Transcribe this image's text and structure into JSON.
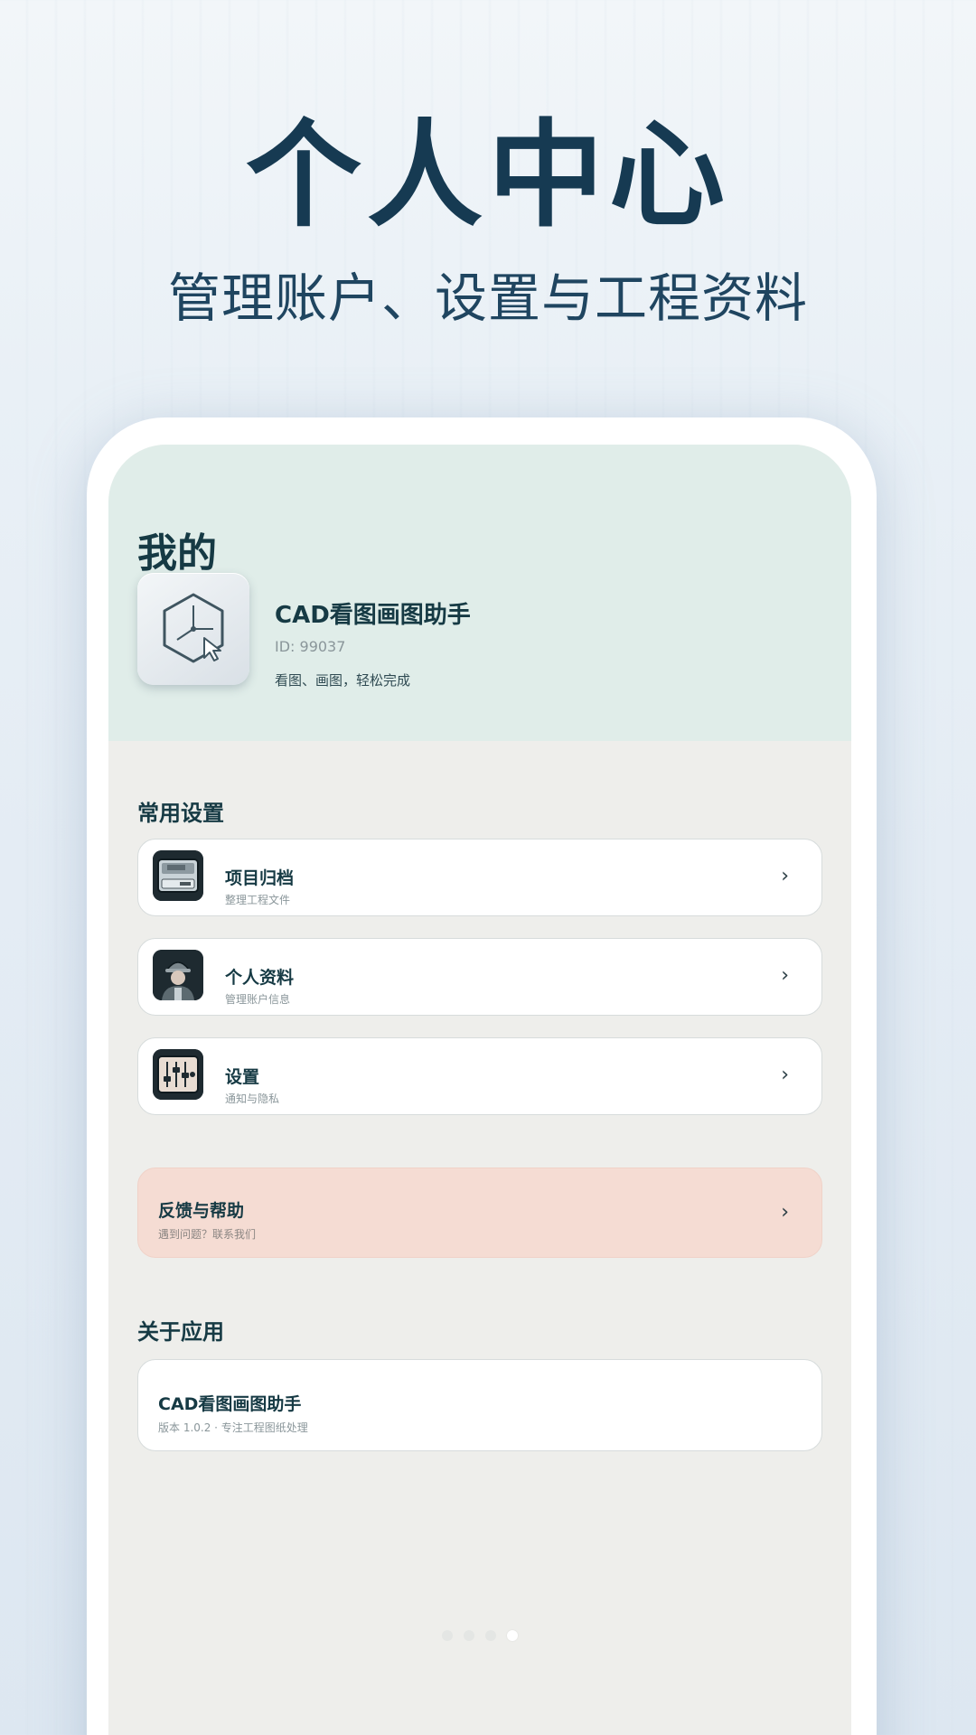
{
  "hero": {
    "title": "个人中心",
    "subtitle": "管理账户、设置与工程资料"
  },
  "page": {
    "title": "我的"
  },
  "profile": {
    "app_icon": "cube-cursor-icon",
    "name": "CAD看图画图助手",
    "id": "ID: 99037",
    "slogan": "看图、画图，轻松完成"
  },
  "common_settings": {
    "label": "常用设置",
    "items": [
      {
        "icon": "archive-drive-icon",
        "title": "项目归档",
        "subtitle": "整理工程文件"
      },
      {
        "icon": "engineer-avatar-icon",
        "title": "个人资料",
        "subtitle": "管理账户信息"
      },
      {
        "icon": "sliders-icon",
        "title": "设置",
        "subtitle": "通知与隐私"
      }
    ]
  },
  "feedback": {
    "title": "反馈与帮助",
    "subtitle": "遇到问题？联系我们"
  },
  "about": {
    "label": "关于应用",
    "title": "CAD看图画图助手",
    "subtitle": "版本 1.0.2 · 专注工程图纸处理"
  },
  "pager": {
    "count": 4,
    "active_index": 3
  },
  "colors": {
    "accent": "#163a52",
    "header_bg": "#e0ede9",
    "feedback_bg": "#f5dcd3"
  }
}
